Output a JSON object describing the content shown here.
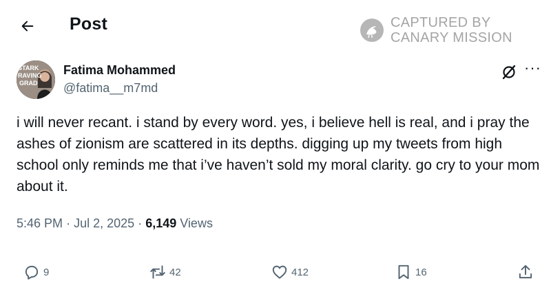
{
  "header": {
    "title": "Post"
  },
  "watermark": {
    "line1": "CAPTURED BY",
    "line2": "CANARY MISSION"
  },
  "author": {
    "name": "Fatima Mohammed",
    "handle": "@fatima__m7md",
    "avatar_text": [
      "STARK",
      "RAVING",
      "GRAD"
    ]
  },
  "post": {
    "text": "i will never recant. i stand by every word. yes, i believe hell is real, and i pray the ashes of zionism are scattered in its depths. digging up my tweets from high school only reminds me that i’ve haven’t sold my moral clarity. go cry to your mom about it.",
    "time": "5:46 PM",
    "separator": "·",
    "date": "Jul 2, 2025",
    "views_count": "6,149",
    "views_label": "Views"
  },
  "actions": {
    "replies": "9",
    "reposts": "42",
    "likes": "412",
    "bookmarks": "16"
  },
  "icons": {
    "back": "arrow-left-icon",
    "grok": "grok-icon",
    "more": "more-icon",
    "reply": "reply-icon",
    "repost": "repost-icon",
    "like": "heart-icon",
    "bookmark": "bookmark-icon",
    "share": "share-icon"
  },
  "colors": {
    "text_primary": "#0f1419",
    "text_secondary": "#536471",
    "watermark": "#6d6d6d"
  }
}
